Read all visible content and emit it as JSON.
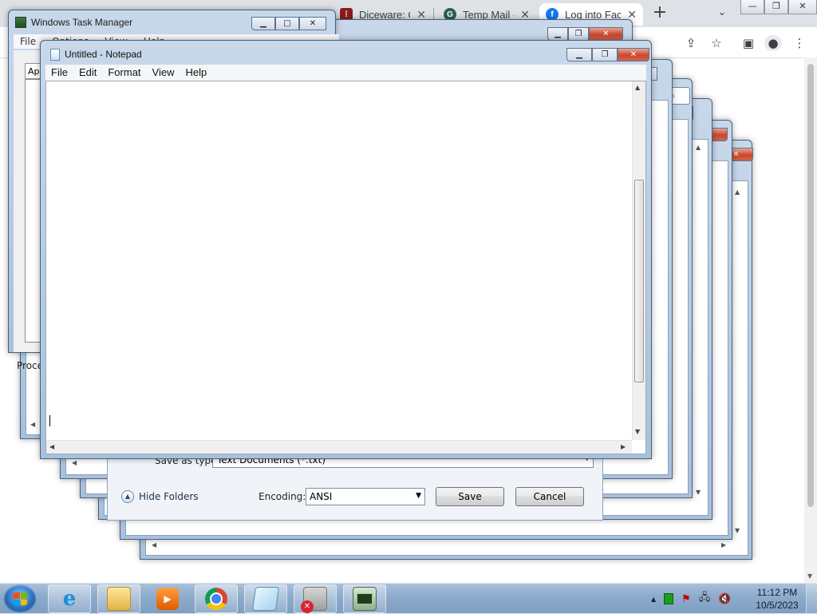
{
  "chrome": {
    "tabs": [
      {
        "label": "Diceware: Cr",
        "favicon": "diceware-icon",
        "color": "#8b1c1c"
      },
      {
        "label": "Temp Mail -",
        "favicon": "tempmail-icon",
        "color": "#2e5f52"
      },
      {
        "label": "Log into Fac",
        "favicon": "facebook-icon",
        "color": "#1877f2"
      }
    ],
    "new_tab": "+",
    "close_glyph": "✕"
  },
  "task_manager": {
    "title": "Windows Task Manager",
    "menu": [
      "File",
      "Options",
      "View",
      "Help"
    ],
    "tab_applications": "App",
    "processes_label": "Proce"
  },
  "save_dialog": {
    "save_as_type_label": "Save as type:",
    "save_as_type_value": "Text Documents (*.txt)",
    "hide_folders": "Hide Folders",
    "encoding_label": "Encoding:",
    "encoding_value": "ANSI",
    "save_button": "Save",
    "cancel_button": "Cancel"
  },
  "notepad": {
    "title": "Untitled - Notepad",
    "menu": [
      "File",
      "Edit",
      "Format",
      "View",
      "Help"
    ],
    "content": ""
  },
  "taskbar": {
    "apps": [
      "internet-explorer-icon",
      "windows-explorer-icon",
      "media-player-icon",
      "chrome-icon",
      "notepad-icon",
      "error-app-icon",
      "task-manager-icon"
    ],
    "time": "11:12 PM",
    "date": "10/5/2023"
  },
  "colors": {
    "chrome_tabbar": "#dee1e6",
    "aero_frame": "#b6cbe2",
    "close_button": "#c9462c",
    "taskbar": "#8eaccc"
  }
}
